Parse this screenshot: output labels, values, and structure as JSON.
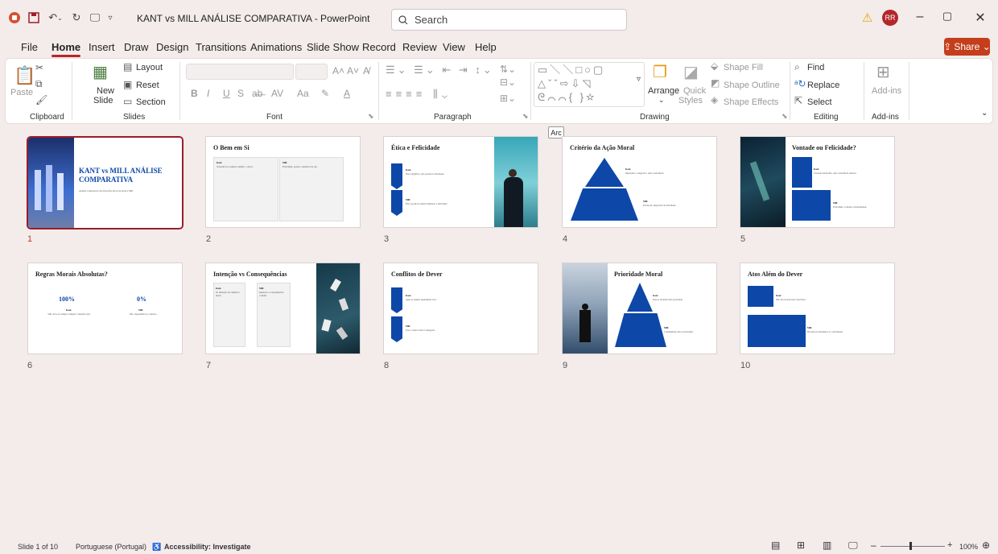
{
  "titlebar": {
    "doc_title": "KANT vs MILL ANÁLISE COMPARATIVA  -  PowerPoint",
    "search_placeholder": "Search",
    "avatar_initials": "RR"
  },
  "menu": {
    "items": [
      "File",
      "Home",
      "Insert",
      "Draw",
      "Design",
      "Transitions",
      "Animations",
      "Slide Show",
      "Record",
      "Review",
      "View",
      "Help"
    ],
    "share": "Share"
  },
  "ribbon": {
    "clipboard": {
      "paste": "Paste",
      "label": "Clipboard"
    },
    "slides": {
      "new_slide_1": "New",
      "new_slide_2": "Slide",
      "layout": "Layout",
      "reset": "Reset",
      "section": "Section",
      "label": "Slides"
    },
    "font": {
      "label": "Font",
      "bold": "B",
      "italic": "I",
      "underline": "U",
      "strike": "S"
    },
    "paragraph": {
      "label": "Paragraph"
    },
    "drawing": {
      "arrange": "Arrange",
      "quick1": "Quick",
      "quick2": "Styles",
      "shape_fill": "Shape Fill",
      "shape_outline": "Shape Outline",
      "shape_effects": "Shape Effects",
      "label": "Drawing"
    },
    "editing": {
      "find": "Find",
      "replace": "Replace",
      "select": "Select",
      "label": "Editing"
    },
    "addins": {
      "addins": "Add-ins",
      "label": "Add-ins"
    }
  },
  "tooltip": "Arc",
  "slides": [
    {
      "n": "1",
      "title": "KANT vs MILL ANÁLISE COMPARATIVA",
      "subtitle": "Análise comparativa das filosofias éticas de Kant e Mill."
    },
    {
      "n": "2",
      "title": "O Bem em Si",
      "kant": "Kant",
      "kant_text": "Vontade boa, sempre cumprir o dever.",
      "mill": "Mill",
      "mill_text": "Felicidade, prazer e ausência de dor."
    },
    {
      "n": "3",
      "title": "Ética e Felicidade",
      "kant": "Kant",
      "kant_text": "Ética dignifica, não promove felicidade.",
      "mill": "Mill",
      "mill_text": "Ética promove imparcialmente a felicidade."
    },
    {
      "n": "4",
      "title": "Critério da Ação Moral",
      "kant": "Kant",
      "kant_text": "Imperativo categórico, sem contradição.",
      "mill": "Mill",
      "mill_text": "Promoção imparcial da felicidade."
    },
    {
      "n": "5",
      "title": "Vontade ou Felicidade?",
      "kant": "Kant",
      "kant_text": "Vontade autônoma, sem contradição interna.",
      "mill": "Mill",
      "mill_text": "Felicidade, vontade é instrumental."
    },
    {
      "n": "6",
      "title": "Regras Morais Absolutas?",
      "kant_pct": "100%",
      "kant": "Kant",
      "kant_text": "Sim, deve-se sempre cumprir a mesma ação.",
      "mill_pct": "0%",
      "mill": "Mill",
      "mill_text": "Não, dependem do contexto."
    },
    {
      "n": "7",
      "title": "Intenção vs Consequências",
      "kant": "Kant",
      "kant_text": "Só intenção de cumprir o dever.",
      "mill": "Mill",
      "mill_text": "Intenção e consequências contam."
    },
    {
      "n": "8",
      "title": "Conflitos de Dever",
      "kant": "Kant",
      "kant_text": "Agir-se sempre igualmente real.",
      "mill": "Mill",
      "mill_text": "Usar o maior bem à obrigação."
    },
    {
      "n": "9",
      "title": "Prioridade Moral",
      "kant": "Kant",
      "kant_text": "Pessoa incluída tem prioridade.",
      "mill": "Mill",
      "mill_text": "Comunidade tem a prioridade."
    },
    {
      "n": "10",
      "title": "Atos Além do Dever",
      "kant": "Kant",
      "kant_text": "Não são morais mas louváveis.",
      "mill": "Mill",
      "mill_text": "Devem ser mandados se contribuem."
    }
  ],
  "status": {
    "slide": "Slide 1 of 10",
    "language": "Portuguese (Portugal)",
    "accessibility": "Accessibility: Investigate",
    "zoom": "100%"
  }
}
